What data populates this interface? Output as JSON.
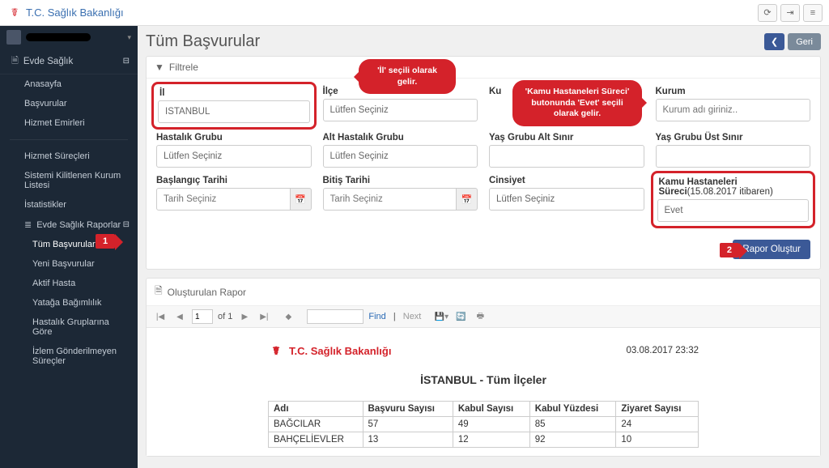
{
  "brand": "T.C. Sağlık Bakanlığı",
  "page_title": "Tüm Başvurular",
  "back_label": "Geri",
  "section_title": "Evde Sağlık",
  "nav": {
    "anasayfa": "Anasayfa",
    "basvurular": "Başvurular",
    "hizmet_emirleri": "Hizmet Emirleri",
    "hizmet_surecleri": "Hizmet Süreçleri",
    "sistemi_kitlenen": "Sistemi Kilitlenen Kurum Listesi",
    "istatistikler": "İstatistikler",
    "raporlar": "Evde Sağlık Raporlar",
    "tum_basvurular": "Tüm Başvurular",
    "yeni_basvurular": "Yeni Başvurular",
    "aktif_hasta": "Aktif Hasta",
    "yataga": "Yatağa Bağımlılık",
    "hastalik_grup": "Hastalık Gruplarına Göre",
    "izlem": "İzlem Gönderilmeyen Süreçler"
  },
  "filter_header": "Filtrele",
  "filters": {
    "il_label": "İl",
    "il_value": "İSTANBUL",
    "ilce_label": "İlçe",
    "ilce_value": "Lütfen Seçiniz",
    "kur_label": "Ku",
    "kur_label2": "ku",
    "kurum_label": "Kurum",
    "kurum_placeholder": "Kurum adı giriniz..",
    "hastalik_label": "Hastalık Grubu",
    "hastalik_value": "Lütfen Seçiniz",
    "alt_hastalik_label": "Alt Hastalık Grubu",
    "alt_hastalik_value": "Lütfen Seçiniz",
    "yas_alt_label": "Yaş Grubu Alt Sınır",
    "yas_ust_label": "Yaş Grubu Üst Sınır",
    "baslangic_label": "Başlangıç Tarihi",
    "baslangic_placeholder": "Tarih Seçiniz",
    "bitis_label": "Bitiş Tarihi",
    "bitis_placeholder": "Tarih Seçiniz",
    "cinsiyet_label": "Cinsiyet",
    "cinsiyet_value": "Lütfen Seçiniz",
    "kamu_label": "Kamu Hastaneleri Süreci",
    "kamu_suffix": "(15.08.2017 itibaren)",
    "kamu_value": "Evet"
  },
  "callout1_text": "'İl' seçili olarak gelir.",
  "callout2_text": "'Kamu Hastaneleri Süreci' butonunda 'Evet' seçili olarak gelir.",
  "badge1": "1",
  "badge2": "2",
  "btn_rapor": "Rapor Oluştur",
  "report_header": "Oluşturulan Rapor",
  "toolbar": {
    "page_current": "1",
    "page_of": "of 1",
    "find": "Find",
    "next": "Next"
  },
  "report": {
    "brand": "T.C. Sağlık Bakanlığı",
    "date": "03.08.2017 23:32",
    "title": "İSTANBUL - Tüm İlçeler",
    "columns": {
      "adi": "Adı",
      "basvuru": "Başvuru Sayısı",
      "kabul_sayisi": "Kabul Sayısı",
      "kabul_yuzdesi": "Kabul Yüzdesi",
      "ziyaret": "Ziyaret Sayısı"
    },
    "rows": [
      {
        "adi": "BAĞCILAR",
        "basvuru": "57",
        "kabul_sayisi": "49",
        "kabul_yuzdesi": "85",
        "ziyaret": "24"
      },
      {
        "adi": "BAHÇELİEVLER",
        "basvuru": "13",
        "kabul_sayisi": "12",
        "kabul_yuzdesi": "92",
        "ziyaret": "10"
      }
    ]
  }
}
